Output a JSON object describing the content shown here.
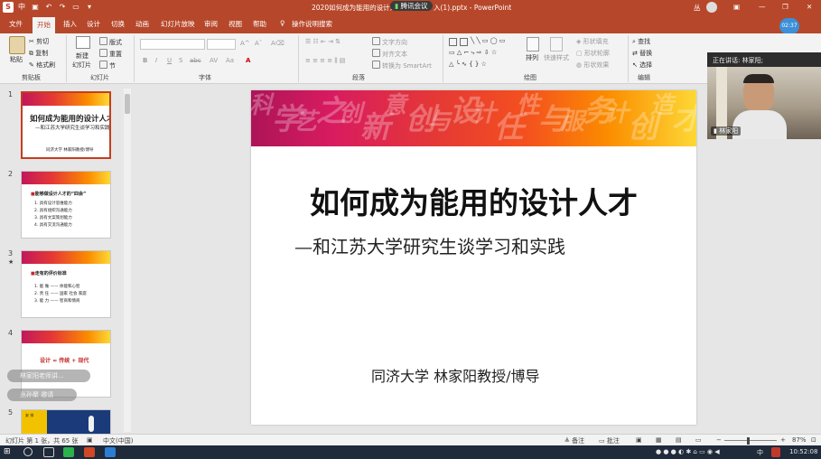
{
  "window": {
    "title": "2020如何成为能用的设计人... 腾讯会议 ...入(1).pptx - PowerPoint",
    "title_left": "2020如何成为能用的设计人",
    "title_mid": "腾讯会议",
    "title_right": "入(1).pptx  -  PowerPoint",
    "user_label": "丛",
    "share_label": "共享",
    "timer": "02:37"
  },
  "quick_access": {
    "logo": "S",
    "lang": "中"
  },
  "tabs": [
    "文件",
    "开始",
    "插入",
    "设计",
    "切换",
    "动画",
    "幻灯片放映",
    "审阅",
    "视图",
    "帮助",
    "操作说明搜索"
  ],
  "ribbon": {
    "clipboard": {
      "label": "剪贴板",
      "paste": "粘贴",
      "cut": "剪切",
      "copy": "复制",
      "format_painter": "格式刷"
    },
    "slides": {
      "label": "幻灯片",
      "new_slide": "新建",
      "new_slide2": "幻灯片",
      "layout": "版式",
      "reset": "重置",
      "section": "节"
    },
    "font": {
      "label": "字体",
      "bold": "B",
      "italic": "I",
      "underline": "U",
      "shadow": "S",
      "strike": "abc"
    },
    "paragraph": {
      "label": "段落",
      "text_direction": "文字方向",
      "align_text": "对齐文本",
      "smartart": "转换为 SmartArt"
    },
    "drawing": {
      "label": "绘图",
      "arrange": "排列",
      "quick_styles": "快速样式",
      "shape_fill": "形状填充",
      "shape_outline": "形状轮廓",
      "shape_effects": "形状效果"
    },
    "editing": {
      "label": "编辑",
      "find": "查找",
      "replace": "替换",
      "select": "选择"
    }
  },
  "slides_panel": {
    "slides": [
      {
        "num": "1",
        "title": "如何成为能用的设计人才",
        "subtitle": "—和江苏大学研究生谈学习和实践",
        "footer": "同济大学  林家阳教授/博导"
      },
      {
        "num": "2",
        "title": "能够做设计人才的“四会”",
        "items": [
          "1. 具有设计思维能力",
          "2. 具有组织沟通能力",
          "3. 具有文案策划能力",
          "4. 具有交流沟通能力"
        ]
      },
      {
        "num": "3",
        "star": "★",
        "title": "走有的评价标准",
        "items": [
          "1. 能  做 —— 体能和心智",
          "2. 责  任 —— 国家  社会  家庭",
          "3. 能  力 —— 智商和情商"
        ]
      },
      {
        "num": "4",
        "title": "设计 ≈ 传统 + 现代"
      },
      {
        "num": "5",
        "title": "安  排"
      }
    ]
  },
  "overlay": {
    "pill1": "林家阳老师讲...",
    "pill2": "丛孙聚 邀请"
  },
  "main_slide": {
    "title": "如何成为能用的设计人才",
    "subtitle": "—和江苏大学研究生谈学习和实践",
    "footer": "同济大学  林家阳教授/博导",
    "banner_chars": [
      "科",
      "学",
      "艺",
      "之",
      "创",
      "新",
      "意",
      "创",
      "与",
      "设",
      "计",
      "任",
      "性",
      "与",
      "服",
      "务",
      "计",
      "创",
      "造",
      "才"
    ]
  },
  "video": {
    "speaking_label": "正在讲话: 林家阳;",
    "name": "林家阳"
  },
  "statusbar": {
    "slide_info": "幻灯片 第 1 张，共 65 张",
    "language": "中文(中国)",
    "notes": "备注",
    "comments": "批注",
    "zoom": "87%"
  },
  "taskbar": {
    "time": "10:52:08",
    "ime": "中"
  }
}
